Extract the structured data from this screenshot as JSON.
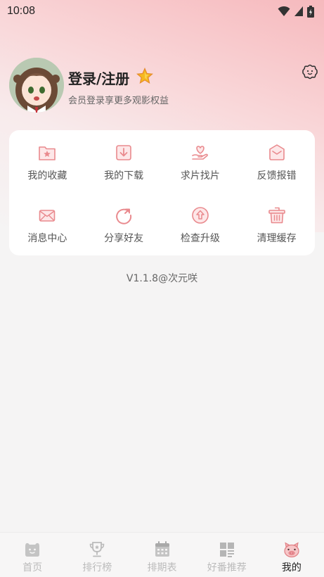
{
  "status_bar": {
    "time": "10:08"
  },
  "profile": {
    "title": "登录/注册",
    "subtitle": "会员登录享更多观影权益"
  },
  "menu": [
    {
      "label": "我的收藏",
      "icon": "favorites-folder-icon"
    },
    {
      "label": "我的下载",
      "icon": "download-icon"
    },
    {
      "label": "求片找片",
      "icon": "request-heart-icon"
    },
    {
      "label": "反馈报错",
      "icon": "feedback-envelope-icon"
    },
    {
      "label": "消息中心",
      "icon": "message-mail-icon"
    },
    {
      "label": "分享好友",
      "icon": "share-icon"
    },
    {
      "label": "检查升级",
      "icon": "upgrade-icon"
    },
    {
      "label": "清理缓存",
      "icon": "trash-icon"
    }
  ],
  "version": "V1.1.8@次元咲",
  "tabs": [
    {
      "label": "首页",
      "icon": "home-bear-icon",
      "active": false
    },
    {
      "label": "排行榜",
      "icon": "trophy-icon",
      "active": false
    },
    {
      "label": "排期表",
      "icon": "calendar-icon",
      "active": false
    },
    {
      "label": "好番推荐",
      "icon": "grid-recommend-icon",
      "active": false
    },
    {
      "label": "我的",
      "icon": "pig-face-icon",
      "active": true
    }
  ],
  "colors": {
    "accent": "#e98a8e",
    "tab_inactive": "#bbbbbb",
    "tab_active": "#222222"
  }
}
